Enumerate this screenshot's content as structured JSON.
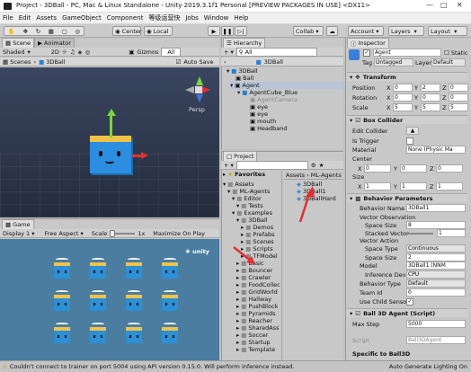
{
  "window": {
    "title": "Project - 3DBall - PC, Mac & Linux Standalone - Unity 2019.3.1f1 Personal [PREVIEW PACKAGES IN USE] <DX11>"
  },
  "menu": [
    "File",
    "Edit",
    "Assets",
    "GameObject",
    "Component",
    "等级运营快",
    "Jobs",
    "Window",
    "Help"
  ],
  "toolbar": {
    "center": "Center",
    "local": "Local",
    "collab": "Collab",
    "account": "Account",
    "layers": "Layers",
    "layout": "Layout"
  },
  "scene": {
    "tab_scene": "Scene",
    "tab_animator": "Animator",
    "shaded": "Shaded",
    "mode2d": "2D",
    "gizmos": "Gizmos",
    "all": "All",
    "scenes_label": "Scenes",
    "scene_name": "3DBall",
    "auto_save": "Auto Save",
    "persp": "Persp"
  },
  "hierarchy": {
    "tab": "Hierarchy",
    "create": "Create",
    "all": "All",
    "scene_name": "3DBall",
    "items": [
      "Ball",
      "Agent",
      "AgentCube_Blue",
      "AgentCamera",
      "eye",
      "eye",
      "mouth",
      "Headband"
    ]
  },
  "game": {
    "tab": "Game",
    "display": "Display 1",
    "aspect": "Free Aspect",
    "scale_label": "Scale",
    "scale_value": "1x",
    "maximize": "Maximize On Play",
    "unity_logo": "unity"
  },
  "project": {
    "tab": "Project",
    "create": "Create",
    "favorites": "Favorites",
    "assets": "Assets",
    "tree": [
      "Assets",
      "ML-Agents",
      "Editor",
      "Tests",
      "Examples",
      "3DBall",
      "Demos",
      "Prefabs",
      "Scenes",
      "Scripts",
      "TFModel",
      "Basic",
      "Bouncer",
      "Crawler",
      "FoodCollec",
      "GridWorld",
      "Hallway",
      "PushBlock",
      "Pyramids",
      "Reacher",
      "SharedAss",
      "Soccer",
      "Startup",
      "Template"
    ],
    "breadcrumb": [
      "Assets",
      "ML-Agents"
    ],
    "files": [
      "3DBall",
      "3DBall1",
      "3DBallHard"
    ]
  },
  "inspector": {
    "tab": "Inspector",
    "name": "Agent",
    "static": "Static",
    "tag_label": "Tag",
    "tag_value": "Untagged",
    "layer_label": "Layer",
    "layer_value": "Default",
    "transform": {
      "title": "Transform",
      "rows": [
        {
          "label": "Position",
          "x": "0",
          "y": "2",
          "z": "0"
        },
        {
          "label": "Rotation",
          "x": "0",
          "y": "0",
          "z": "0"
        },
        {
          "label": "Scale",
          "x": "5",
          "y": "5",
          "z": "5"
        }
      ]
    },
    "box_collider": {
      "title": "Box Collider",
      "edit_collider": "Edit Collider",
      "is_trigger": "Is Trigger",
      "material_label": "Material",
      "material_value": "None (Physic Ma",
      "center_label": "Center",
      "center": {
        "x": "0",
        "y": "0",
        "z": "0"
      },
      "size_label": "Size",
      "size": {
        "x": "1",
        "y": "1",
        "z": "1"
      }
    },
    "behavior": {
      "title": "Behavior Parameters",
      "name_label": "Behavior Name",
      "name_value": "3DBall1",
      "vec_obs": "Vector Observation",
      "space_size_label": "Space Size",
      "space_size_value": "8",
      "stacked_label": "Stacked Vector",
      "stacked_value": "1",
      "vec_act": "Vector Action",
      "space_type_label": "Space Type",
      "space_type_value": "Continuous",
      "act_size_label": "Space Size",
      "act_size_value": "2",
      "model_label": "Model",
      "model_value": "3DBall1 (NNM",
      "inference_label": "Inference Devic",
      "inference_value": "CPU",
      "btype_label": "Behavior Type",
      "btype_value": "Default",
      "team_label": "Team Id",
      "team_value": "0",
      "child_label": "Use Child Sensors"
    },
    "agent_script": {
      "title": "Ball 3D Agent (Script)",
      "max_step_label": "Max Step",
      "max_step_value": "5000",
      "script_label": "Script",
      "script_value": "Ball3DAgent",
      "specific": "Specific to Ball3D"
    }
  },
  "status": {
    "message": "Couldn't connect to trainer on port 5004 using API version 0.15.0. Will perform inference instead.",
    "right": "Auto Generate Lighting On"
  },
  "colors": {
    "scene_sky": "#2f3c52",
    "game_bg": "#4a7da0",
    "cube_blue": "#2b90d6",
    "headband": "#f0c24a",
    "red_arrow": "#e23030"
  }
}
